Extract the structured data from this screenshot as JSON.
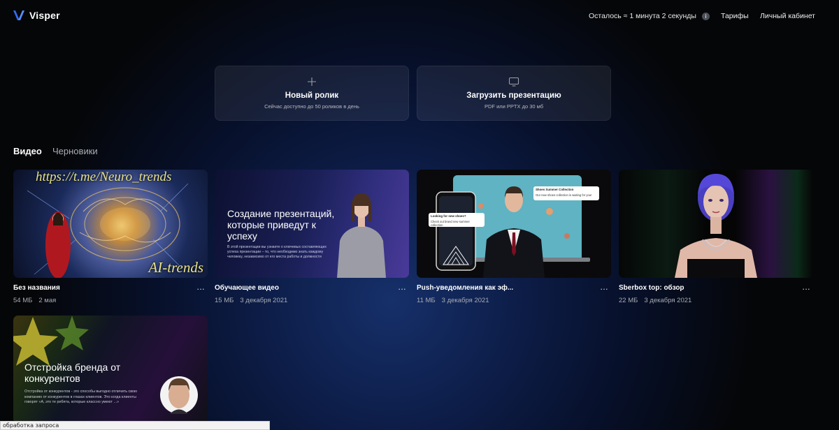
{
  "header": {
    "brand": "Visper",
    "remaining_label": "Осталось ≈ 1 минута 2 секунды",
    "info_icon": "i",
    "nav": [
      "Тарифы",
      "Личный кабинет"
    ]
  },
  "actions": [
    {
      "icon": "plus-icon",
      "title": "Новый ролик",
      "subtitle": "Сейчас доступно до 50 роликов в день"
    },
    {
      "icon": "monitor-icon",
      "title": "Загрузить презентацию",
      "subtitle": "PDF или PPTX до 30 мб"
    }
  ],
  "tabs": [
    {
      "label": "Видео",
      "active": true
    },
    {
      "label": "Черновики",
      "active": false
    }
  ],
  "videos": [
    {
      "title": "Без названия",
      "size": "54 МБ",
      "date": "2 мая",
      "thumb": {
        "overlay_top": "https://t.me/Neuro_trends",
        "overlay_bottom": "AI-trends"
      }
    },
    {
      "title": "Обучающее видео",
      "size": "15 МБ",
      "date": "3 декабря 2021",
      "thumb": {
        "heading": "Создание презентаций, которые приведут к успеху",
        "body": "В этой презентации вы узнаете о ключевых составляющих успеха презентации – то, что необходимо знать каждому человеку, независимо от его места работы и должности"
      }
    },
    {
      "title": "Push-уведомления как эф...",
      "size": "11 МБ",
      "date": "3 декабря 2021",
      "thumb": {
        "notif1_title": "Shoes Summer Collection",
        "notif1_body": "Our new shoes collection is waiting for you!",
        "notif2_title": "Looking for new shoes?",
        "notif2_body": "Check out brand new summer collection"
      }
    },
    {
      "title": "Sberbox top: обзор",
      "size": "22 МБ",
      "date": "3 декабря 2021",
      "thumb": {}
    },
    {
      "title": "",
      "size": "",
      "date": "",
      "thumb": {
        "heading": "Отстройка бренда от конкурентов",
        "body": "Отстройка от конкурентов - это способы выгодно отличить свою компанию от конкурентов в глазах клиентов. Это когда клиенты говорят «А, это те ребята, которые классно умеют ...»"
      }
    }
  ],
  "more_label": "...",
  "status_bar": "обработка запроса",
  "colors": {
    "background": "#050608",
    "glow": "#16306a",
    "card": "#1a1e27"
  }
}
